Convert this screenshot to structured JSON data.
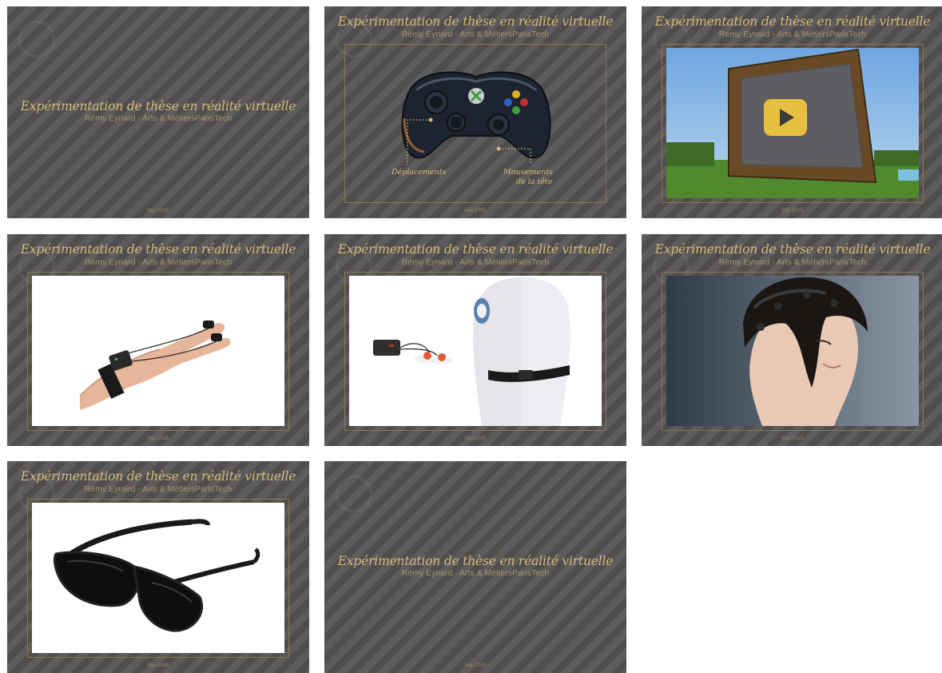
{
  "presentation": {
    "title": "Expérimentation de thèse en réalité virtuelle",
    "author": "Rémy Eynard - Arts & MétiersParisTech",
    "date": "Mai 2015"
  },
  "slides": [
    {
      "id": 1,
      "layout": "title"
    },
    {
      "id": 2,
      "layout": "image",
      "image": "xbox-controller",
      "labels": {
        "left": "Déplacements",
        "right_line1": "Mouvements",
        "right_line2": "de la tête"
      }
    },
    {
      "id": 3,
      "layout": "image",
      "image": "minecraft-video-screen",
      "icon": "play-icon"
    },
    {
      "id": 4,
      "layout": "image",
      "image": "hand-finger-sensor"
    },
    {
      "id": 5,
      "layout": "image",
      "image": "chest-strap-heart-sensor"
    },
    {
      "id": 6,
      "layout": "image",
      "image": "eeg-headset-woman"
    },
    {
      "id": 7,
      "layout": "image",
      "image": "3d-glasses"
    },
    {
      "id": 8,
      "layout": "title"
    }
  ],
  "colors": {
    "slide_background": "#545253",
    "title_gold": "#d6bc78",
    "subtitle_gold": "#a89466"
  }
}
